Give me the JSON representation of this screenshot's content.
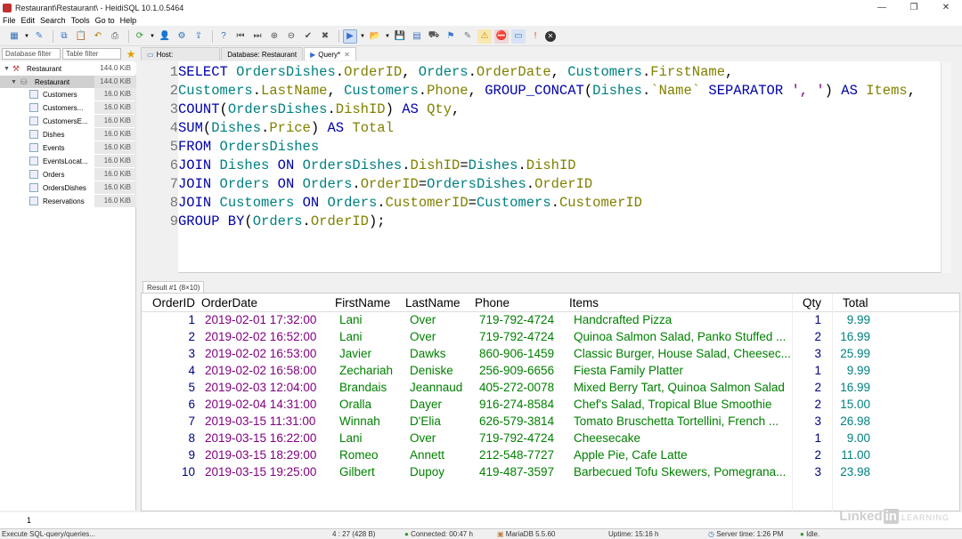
{
  "window": {
    "title": "Restaurant\\Restaurant\\ - HeidiSQL 10.1.0.5464",
    "controls": [
      "—",
      "❐",
      "✕"
    ]
  },
  "menu": [
    "File",
    "Edit",
    "Search",
    "Tools",
    "Go to",
    "Help"
  ],
  "filters": {
    "database_placeholder": "Database filter",
    "table_placeholder": "Table filter"
  },
  "tabs": {
    "host": "Host:",
    "database": "Database: Restaurant",
    "query": "Query*"
  },
  "tree": {
    "root": {
      "label": "Restaurant",
      "size": "144.0 KiB"
    },
    "database": {
      "label": "Restaurant",
      "size": "144.0 KiB"
    },
    "tables": [
      {
        "label": "Customers",
        "size": "16.0 KiB"
      },
      {
        "label": "Customers...",
        "size": "16.0 KiB"
      },
      {
        "label": "CustomersE...",
        "size": "16.0 KiB"
      },
      {
        "label": "Dishes",
        "size": "16.0 KiB"
      },
      {
        "label": "Events",
        "size": "16.0 KiB"
      },
      {
        "label": "EventsLocat...",
        "size": "16.0 KiB"
      },
      {
        "label": "Orders",
        "size": "16.0 KiB"
      },
      {
        "label": "OrdersDishes",
        "size": "16.0 KiB"
      },
      {
        "label": "Reservations",
        "size": "16.0 KiB"
      }
    ]
  },
  "editor": {
    "line_numbers": [
      "1",
      "2",
      "3",
      "4",
      "5",
      "6",
      "7",
      "8",
      "9"
    ]
  },
  "results": {
    "tab_label": "Result #1 (8×10)",
    "columns": [
      "OrderID",
      "OrderDate",
      "FirstName",
      "LastName",
      "Phone",
      "Items",
      "Qty",
      "Total"
    ],
    "rows": [
      [
        "1",
        "2019-02-01 17:32:00",
        "Lani",
        "Over",
        "719-792-4724",
        "Handcrafted Pizza",
        "1",
        "9.99"
      ],
      [
        "2",
        "2019-02-02 16:52:00",
        "Lani",
        "Over",
        "719-792-4724",
        "Quinoa Salmon Salad, Panko Stuffed ...",
        "2",
        "16.99"
      ],
      [
        "3",
        "2019-02-02 16:53:00",
        "Javier",
        "Dawks",
        "860-906-1459",
        "Classic Burger, House Salad, Cheesec...",
        "3",
        "25.99"
      ],
      [
        "4",
        "2019-02-02 16:58:00",
        "Zechariah",
        "Deniske",
        "256-909-6656",
        "Fiesta Family Platter",
        "1",
        "9.99"
      ],
      [
        "5",
        "2019-02-03 12:04:00",
        "Brandais",
        "Jeannaud",
        "405-272-0078",
        "Mixed Berry Tart, Quinoa Salmon Salad",
        "2",
        "16.99"
      ],
      [
        "6",
        "2019-02-04 14:31:00",
        "Oralla",
        "Dayer",
        "916-274-8584",
        "Chef's Salad, Tropical Blue Smoothie",
        "2",
        "15.00"
      ],
      [
        "7",
        "2019-03-15 11:31:00",
        "Winnah",
        "D'Elia",
        "626-579-3814",
        "Tomato Bruschetta Tortellini, French ...",
        "3",
        "26.98"
      ],
      [
        "8",
        "2019-03-15 16:22:00",
        "Lani",
        "Over",
        "719-792-4724",
        "Cheesecake",
        "1",
        "9.00"
      ],
      [
        "9",
        "2019-03-15 18:29:00",
        "Romeo",
        "Annett",
        "212-548-7727",
        "Apple Pie, Cafe Latte",
        "2",
        "11.00"
      ],
      [
        "10",
        "2019-03-15 19:25:00",
        "Gilbert",
        "Dupoy",
        "419-487-3597",
        "Barbecued Tofu Skewers, Pomegrana...",
        "3",
        "23.98"
      ]
    ]
  },
  "query_log": {
    "line_number": "1"
  },
  "status": {
    "message": "Execute SQL-query/queries...",
    "cursor": "4 : 27 (428 B)",
    "connected": "Connected: 00:47 h",
    "server": "MariaDB 5.5.60",
    "uptime": "Uptime: 15:16 h",
    "server_time": "Server time: 1:26 PM",
    "state": "Idle."
  },
  "watermark": {
    "brand": "Linked",
    "in": "in",
    "suffix": "LEARNING"
  }
}
